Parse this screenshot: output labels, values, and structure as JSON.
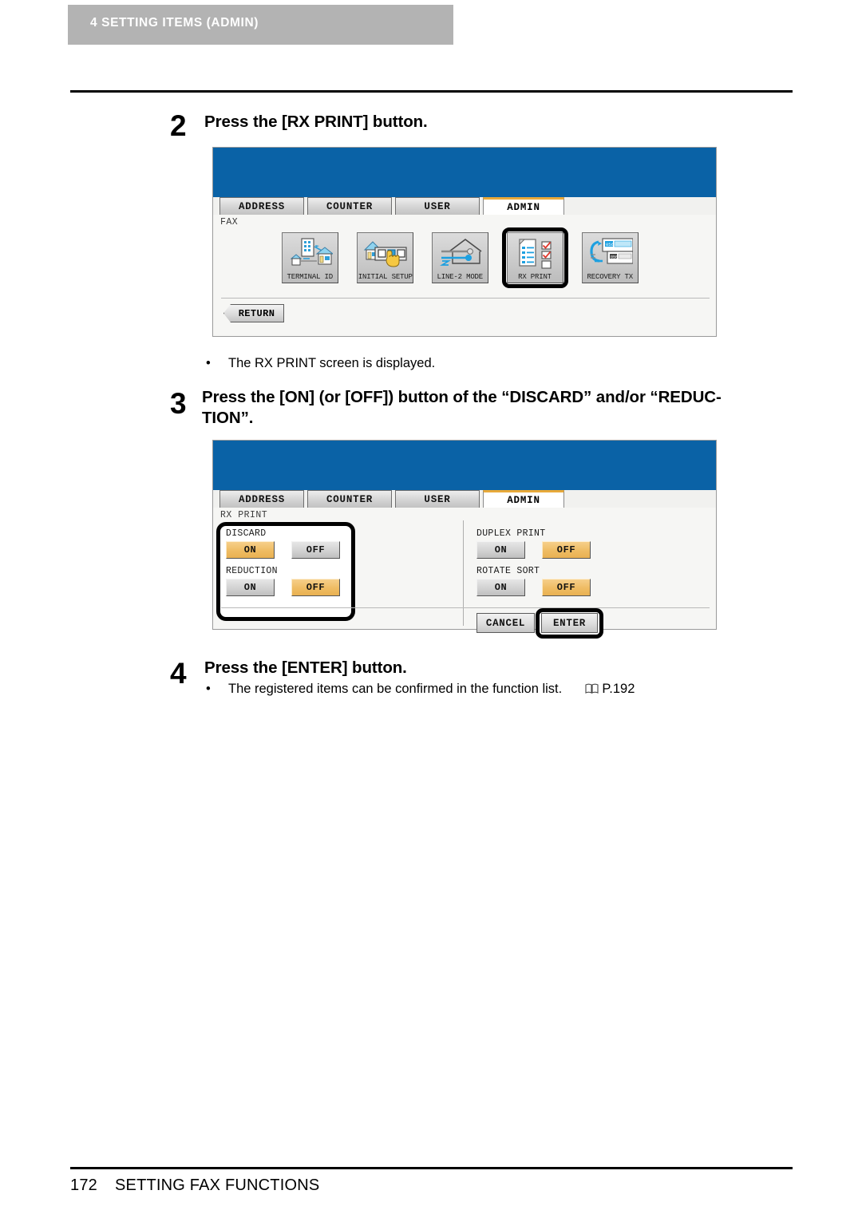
{
  "running_head": {
    "chapter": "4",
    "title": "SETTING ITEMS (ADMIN)",
    "combined": "4   SETTING ITEMS (ADMIN)"
  },
  "steps": [
    {
      "number": "2",
      "title": "Press the [RX PRINT] button.",
      "bullets": [
        {
          "text": "The RX PRINT screen is displayed."
        }
      ]
    },
    {
      "number": "3",
      "title_line1": "Press the [ON] (or [OFF]) button of the “DISCARD” and/or “REDUC-",
      "title_line2": "TION”.",
      "bullets": []
    },
    {
      "number": "4",
      "title": "Press the [ENTER] button.",
      "bullets": [
        {
          "text": "The registered items can be confirmed in the function list.",
          "ref_icon": "book-icon",
          "ref": "P.192"
        }
      ]
    }
  ],
  "screen_one": {
    "tabs": [
      {
        "label": "ADDRESS",
        "active": false
      },
      {
        "label": "COUNTER",
        "active": false
      },
      {
        "label": "USER",
        "active": false
      },
      {
        "label": "ADMIN",
        "active": true
      }
    ],
    "breadcrumb": "FAX",
    "buttons": [
      {
        "label": "TERMINAL ID",
        "icon": "terminal-id-icon",
        "selected": false
      },
      {
        "label": "INITIAL SETUP",
        "icon": "initial-setup-icon",
        "selected": false
      },
      {
        "label": "LINE-2 MODE",
        "icon": "line2-mode-icon",
        "selected": false
      },
      {
        "label": "RX PRINT",
        "icon": "rx-print-icon",
        "selected": true
      },
      {
        "label": "RECOVERY TX",
        "icon": "recovery-tx-icon",
        "selected": false
      }
    ],
    "return_button": "RETURN"
  },
  "screen_two": {
    "tabs": [
      {
        "label": "ADDRESS",
        "active": false
      },
      {
        "label": "COUNTER",
        "active": false
      },
      {
        "label": "USER",
        "active": false
      },
      {
        "label": "ADMIN",
        "active": true
      }
    ],
    "breadcrumb": "RX PRINT",
    "settings_left": [
      {
        "label": "DISCARD",
        "on": "ON",
        "off": "OFF",
        "selected": "ON"
      },
      {
        "label": "REDUCTION",
        "on": "ON",
        "off": "OFF",
        "selected": "OFF"
      }
    ],
    "settings_right": [
      {
        "label": "DUPLEX PRINT",
        "on": "ON",
        "off": "OFF",
        "selected": "OFF"
      },
      {
        "label": "ROTATE SORT",
        "on": "ON",
        "off": "OFF",
        "selected": "OFF"
      }
    ],
    "cancel_button": "CANCEL",
    "enter_button": "ENTER",
    "enter_highlighted": true
  },
  "footer": {
    "page_number": "172",
    "section": "SETTING FAX FUNCTIONS"
  },
  "colors": {
    "header_band": "#b3b3b3",
    "screen_blue": "#0a62a6",
    "tab_active_accent": "#e8a93a",
    "toggle_selected": "#efbc63",
    "screen_bg": "#f6f6f4"
  }
}
